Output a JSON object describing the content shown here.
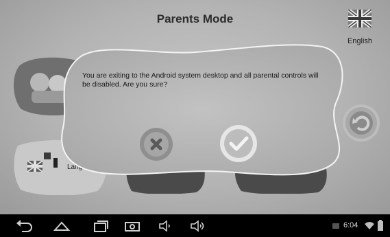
{
  "header": {
    "title": "Parents Mode",
    "language_label": "English"
  },
  "tiles": {
    "language_label": "Langu"
  },
  "dialog": {
    "message": "You are exiting to the Android system desktop and all parental controls will be disabled. Are you sure?",
    "cancel_icon": "x-icon",
    "confirm_icon": "check-icon"
  },
  "navbar": {
    "time": "6:04",
    "icons": [
      "back-icon",
      "home-icon",
      "recent-apps-icon",
      "screenshot-icon",
      "volume-down-icon",
      "volume-up-icon",
      "wifi-icon",
      "battery-icon"
    ]
  }
}
